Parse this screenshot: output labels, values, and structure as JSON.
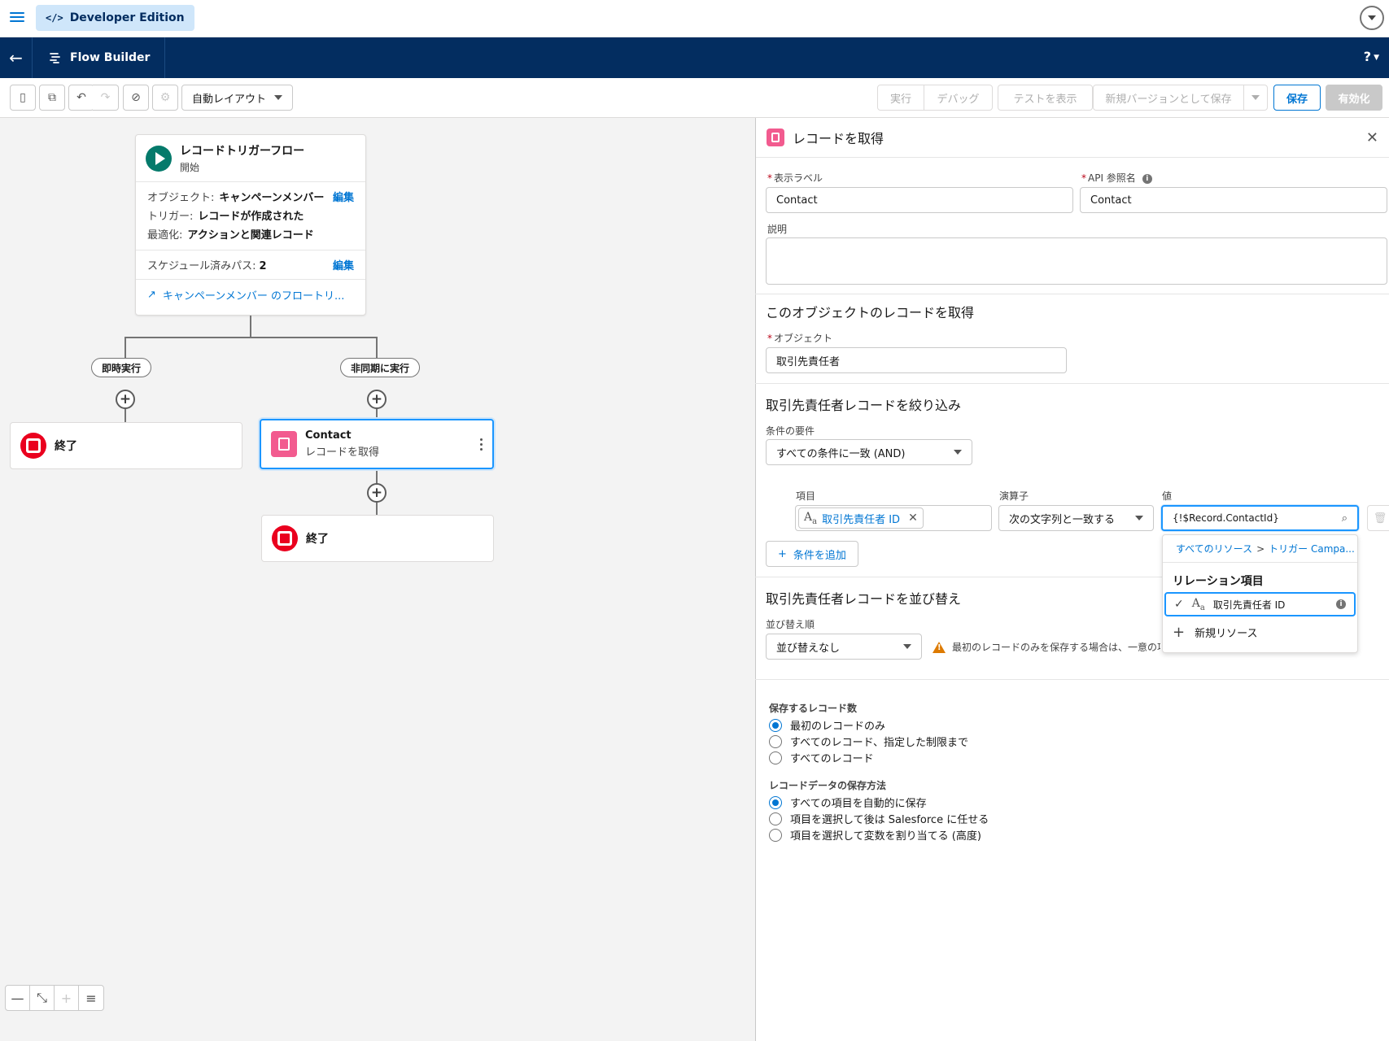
{
  "global": {
    "edition_label": "Developer Edition",
    "edition_icon": "code-icon"
  },
  "app": {
    "title": "Flow Builder",
    "help": "?"
  },
  "toolbar": {
    "layout_select": "自動レイアウト",
    "run": "実行",
    "debug": "デバッグ",
    "show_tests": "テストを表示",
    "save_as_new_version": "新規バージョンとして保存",
    "save": "保存",
    "activate": "有効化"
  },
  "canvas": {
    "start": {
      "title": "レコードトリガーフロー",
      "subtitle": "開始",
      "object_key": "オブジェクト:",
      "object_value": "キャンペーンメンバー",
      "trigger_key": "トリガー:",
      "trigger_value": "レコードが作成された",
      "optimize_key": "最適化:",
      "optimize_value": "アクションと関連レコード",
      "edit": "編集",
      "scheduled_paths_key": "スケジュール済みパス:",
      "scheduled_paths_value": "2",
      "link": "キャンペーンメンバー のフロートリ..."
    },
    "branch_left": "即時実行",
    "branch_right": "非同期に実行",
    "end_label": "終了",
    "element": {
      "title": "Contact",
      "subtitle": "レコードを取得"
    }
  },
  "panel": {
    "title": "レコードを取得",
    "label_field": "表示ラベル",
    "label_value": "Contact",
    "api_field": "API 参照名",
    "api_value": "Contact",
    "description_field": "説明",
    "description_value": "",
    "object_section": "このオブジェクトのレコードを取得",
    "object_field": "オブジェクト",
    "object_value": "取引先責任者",
    "filter_section": "取引先責任者レコードを絞り込み",
    "condition_req_label": "条件の要件",
    "condition_req_value": "すべての条件に一致 (AND)",
    "col_field": "項目",
    "col_operator": "演算子",
    "col_value": "値",
    "cond_field_value": "取引先責任者 ID",
    "cond_operator_value": "次の文字列と一致する",
    "cond_value_value": "{!$Record.ContactId}",
    "add_condition": "条件を追加",
    "sort_section": "取引先責任者レコードを並び替え",
    "sort_label": "並び替え順",
    "sort_value": "並び替えなし",
    "warning": "最初のレコードのみを保存する場合は、一意の項",
    "count_group": "保存するレコード数",
    "count_options": [
      "最初のレコードのみ",
      "すべてのレコード、指定した制限まで",
      "すべてのレコード"
    ],
    "count_selected": 0,
    "store_group": "レコードデータの保存方法",
    "store_options": [
      "すべての項目を自動的に保存",
      "項目を選択して後は Salesforce に任せる",
      "項目を選択して変数を割り当てる (高度)"
    ],
    "store_selected": 0
  },
  "dropdown": {
    "crumb_root": "すべてのリソース",
    "crumb_sep": ">",
    "crumb_child": "トリガー Campa...",
    "group": "リレーション項目",
    "option": "取引先責任者 ID",
    "new_resource": "新規リソース"
  }
}
